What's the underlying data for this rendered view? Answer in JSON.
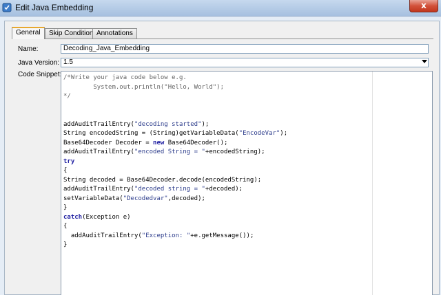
{
  "window": {
    "title": "Edit Java Embedding",
    "close_label": "x"
  },
  "tabs": [
    {
      "label": "General",
      "active": true
    },
    {
      "label": "Skip Condition",
      "active": false
    },
    {
      "label": "Annotations",
      "active": false
    }
  ],
  "form": {
    "name_label": "Name:",
    "name_value": "Decoding_Java_Embedding",
    "java_version_label": "Java Version:",
    "java_version_value": "1.5",
    "code_snippet_label": "Code Snippet:"
  },
  "code_lines": [
    {
      "parts": [
        {
          "t": "/*Write your java code below e.g.",
          "c": "comment"
        }
      ]
    },
    {
      "parts": [
        {
          "t": "        System.out.println(\"Hello, World\");",
          "c": "comment"
        }
      ]
    },
    {
      "parts": [
        {
          "t": "*/",
          "c": "comment"
        }
      ]
    },
    {
      "parts": []
    },
    {
      "parts": []
    },
    {
      "parts": [
        {
          "t": "addAuditTrailEntry(",
          "c": ""
        },
        {
          "t": "\"decoding started\"",
          "c": "str"
        },
        {
          "t": ");",
          "c": ""
        }
      ]
    },
    {
      "parts": [
        {
          "t": "String encodedString = (String)getVariableData(",
          "c": ""
        },
        {
          "t": "\"EncodeVar\"",
          "c": "str"
        },
        {
          "t": ");",
          "c": ""
        }
      ]
    },
    {
      "parts": [
        {
          "t": "Base64Decoder Decoder = ",
          "c": ""
        },
        {
          "t": "new",
          "c": "kw"
        },
        {
          "t": " Base64Decoder();",
          "c": ""
        }
      ]
    },
    {
      "parts": [
        {
          "t": "addAuditTrailEntry(",
          "c": ""
        },
        {
          "t": "\"encoded String = \"",
          "c": "str"
        },
        {
          "t": "+encodedString);",
          "c": ""
        }
      ]
    },
    {
      "parts": [
        {
          "t": "try",
          "c": "kw"
        }
      ]
    },
    {
      "parts": [
        {
          "t": "{",
          "c": ""
        }
      ]
    },
    {
      "parts": [
        {
          "t": "String decoded = Base64Decoder.decode(encodedString);",
          "c": ""
        }
      ]
    },
    {
      "parts": [
        {
          "t": "addAuditTrailEntry(",
          "c": ""
        },
        {
          "t": "\"decoded string = \"",
          "c": "str"
        },
        {
          "t": "+decoded);",
          "c": ""
        }
      ]
    },
    {
      "parts": [
        {
          "t": "setVariableData(",
          "c": ""
        },
        {
          "t": "\"Decodedvar\"",
          "c": "str"
        },
        {
          "t": ",decoded);",
          "c": ""
        }
      ]
    },
    {
      "parts": [
        {
          "t": "}",
          "c": ""
        }
      ]
    },
    {
      "parts": [
        {
          "t": "catch",
          "c": "kw"
        },
        {
          "t": "(Exception e)",
          "c": ""
        }
      ]
    },
    {
      "parts": [
        {
          "t": "{",
          "c": ""
        }
      ]
    },
    {
      "parts": [
        {
          "t": "  addAuditTrailEntry(",
          "c": ""
        },
        {
          "t": "\"Exception: \"",
          "c": "str"
        },
        {
          "t": "+e.getMessage());",
          "c": ""
        }
      ]
    },
    {
      "parts": [
        {
          "t": "}",
          "c": ""
        }
      ]
    }
  ],
  "colors": {
    "accent_tab": "#e8a82e",
    "string": "#2a3a8a",
    "keyword": "#1b1ba0",
    "comment": "#646464"
  }
}
